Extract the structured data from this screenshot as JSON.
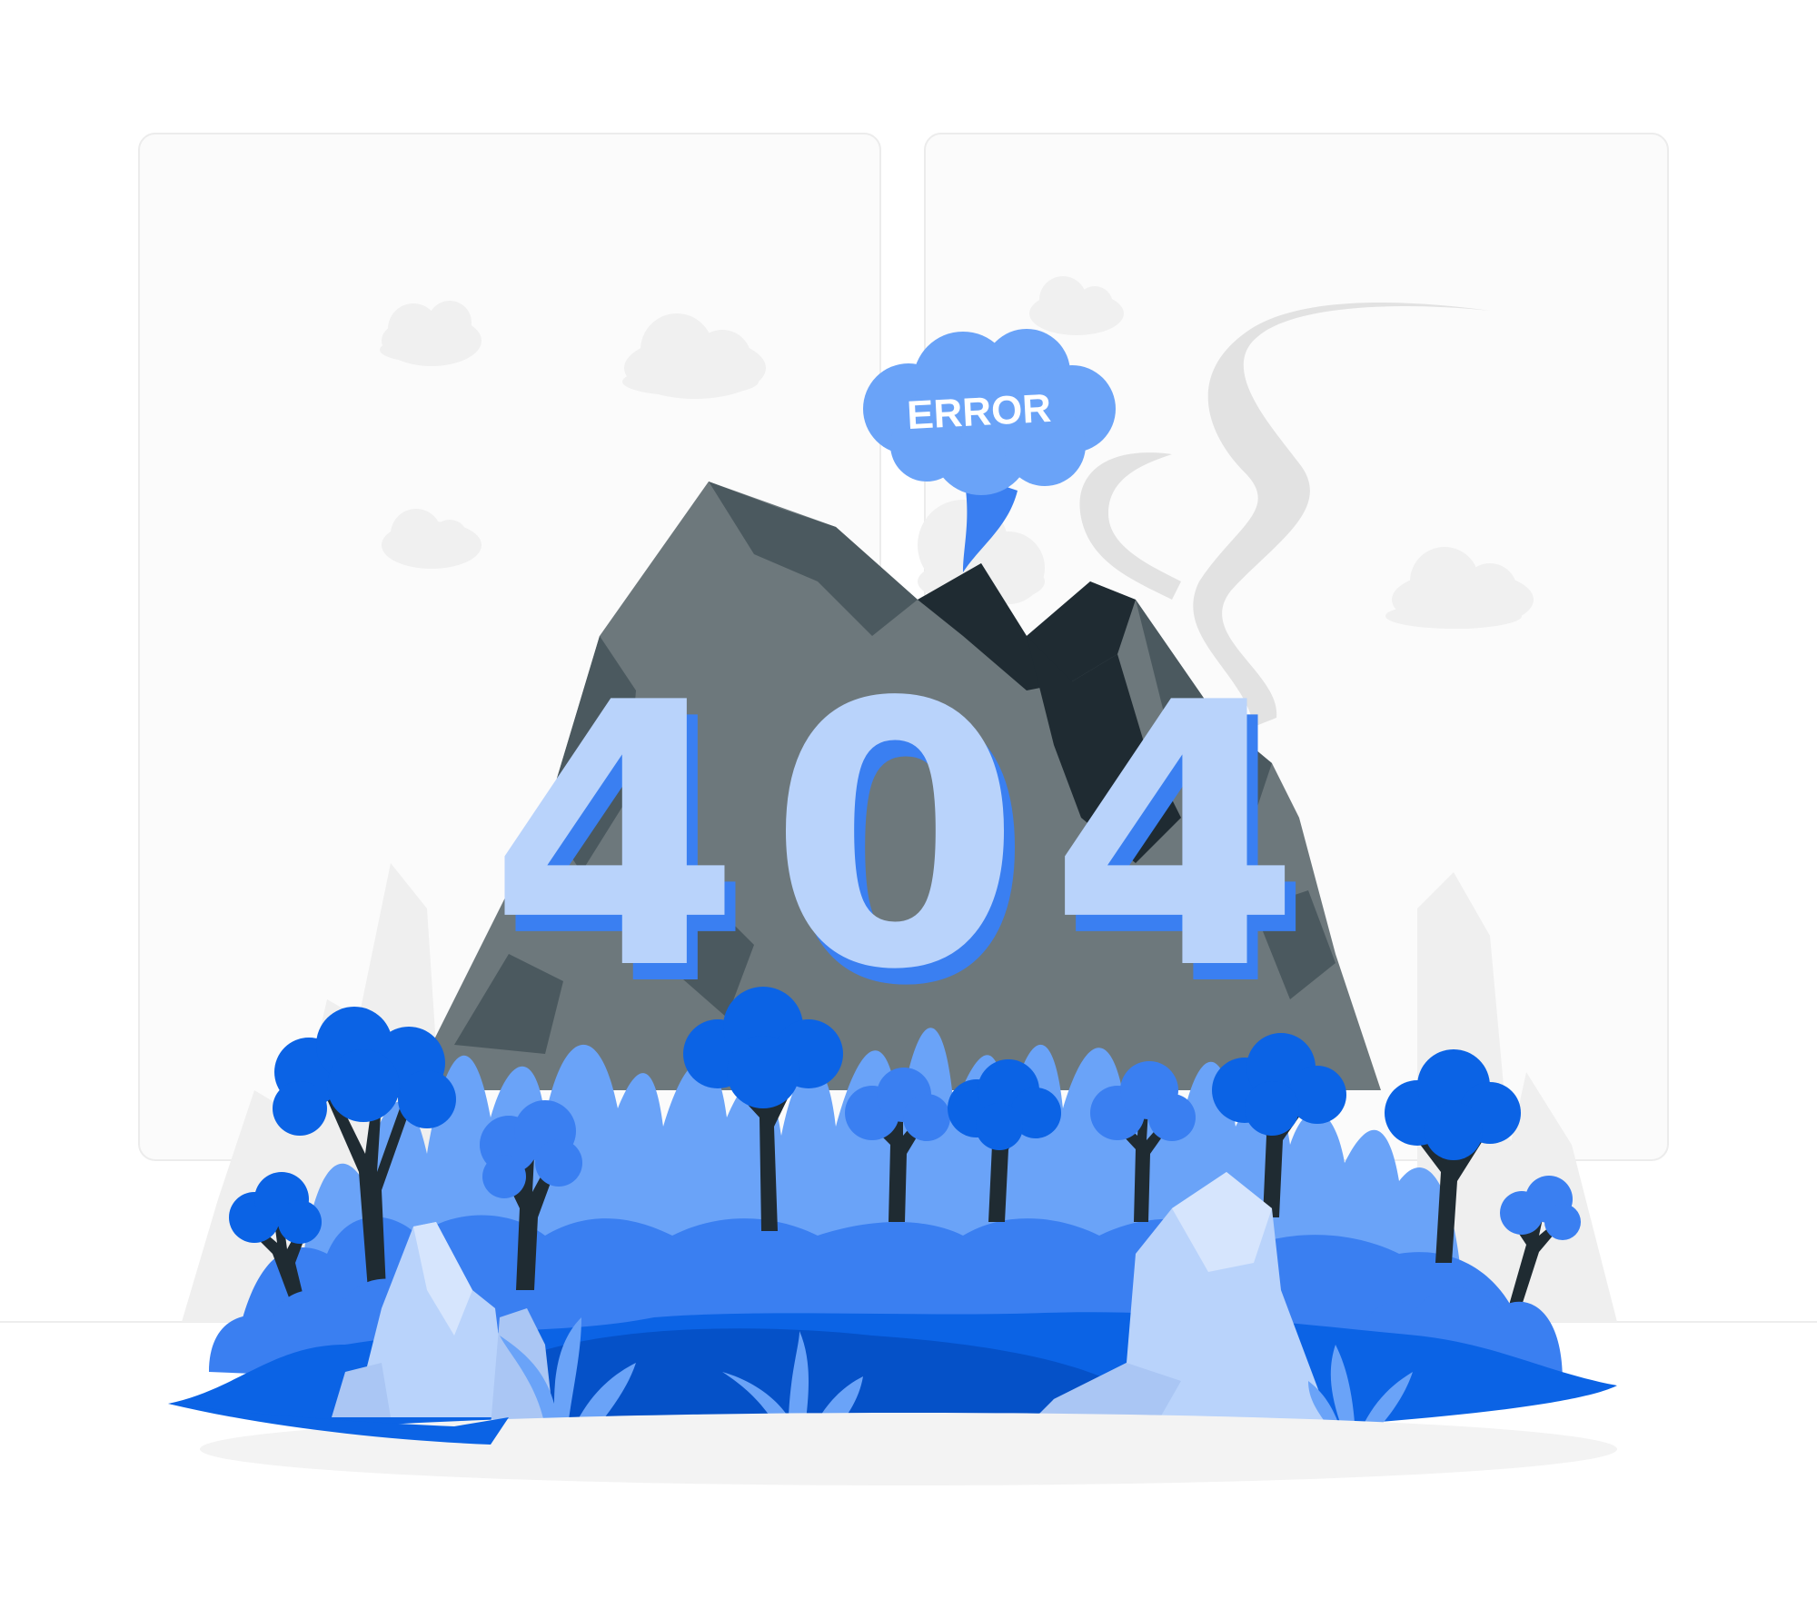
{
  "illustration": {
    "error_code": "404",
    "cloud_label": "ERROR"
  },
  "icons": [
    "mountain",
    "cloud",
    "tree",
    "rock",
    "smoke"
  ],
  "colors": {
    "background": "#ffffff",
    "panel": "#fbfbfb",
    "panel_border": "#ececec",
    "light_blue": "#b9d3fb",
    "mid_blue": "#6aa3f8",
    "blue": "#3a7ff1",
    "dark_blue": "#0b63e5",
    "deep_blue": "#0551c8",
    "rock_dark": "#4b595f",
    "rock_mid": "#6d787c",
    "rock_black": "#1f2b32",
    "smoke": "#e0e0e0",
    "ground_shadow": "#f3f3f3"
  }
}
